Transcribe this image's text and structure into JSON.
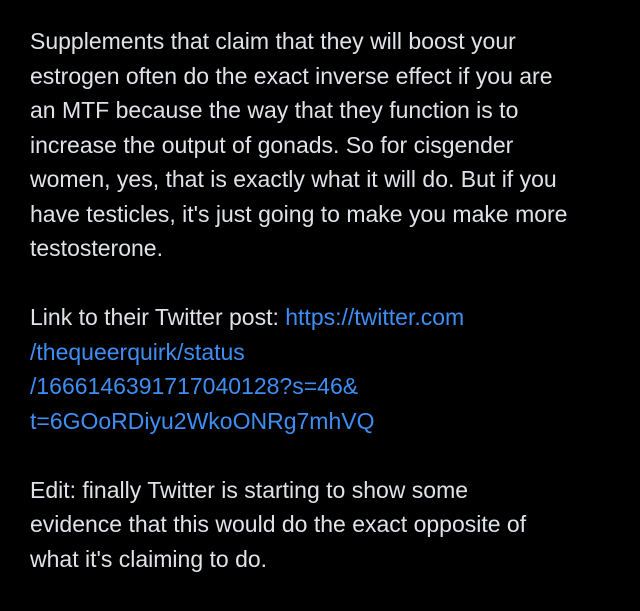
{
  "post": {
    "paragraph_1": {
      "lines": [
        "Supplements that claim that they will boost your",
        "estrogen often do the exact inverse effect if you are",
        "an MTF because the way that they function is to",
        "increase the output of gonads. So for cisgender",
        "women, yes, that is exactly what it will do. But if you",
        "have testicles, it's just going to make you make more",
        "testosterone."
      ]
    },
    "paragraph_2": {
      "prefix": "Link to their Twitter post: ",
      "link_lines": [
        "https://twitter.com",
        "/thequeerquirk/status",
        "/1666146391717040128?s=46&",
        "t=6GOoRDiyu2WkoONRg7mhVQ"
      ]
    },
    "paragraph_3": {
      "lines": [
        "Edit: finally Twitter is starting to show some",
        "evidence that this would do the exact opposite of",
        "what it's claiming to do."
      ]
    }
  },
  "colors": {
    "background": "#000000",
    "text": "#dfe3e8",
    "link": "#3f8ef3"
  }
}
